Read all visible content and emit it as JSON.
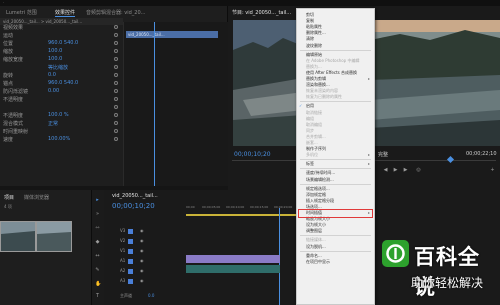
{
  "left_panel": {
    "tabs": [
      "Lumetri 范围",
      "效果控件",
      "音频剪辑混合器: vid_20..."
    ],
    "sequence_clip": "vid_20050..._tail... > vid_20050..._tail...",
    "timeline_clip": "vid_20050..._tail...",
    "props": [
      {
        "label": "视频效果",
        "value": ""
      },
      {
        "label": "运动",
        "value": ""
      },
      {
        "label": "位置",
        "value": "960.0   540.0"
      },
      {
        "label": "缩放",
        "value": "100.0"
      },
      {
        "label": "缩放宽度",
        "value": "100.0"
      },
      {
        "label": "",
        "value": "等比缩放"
      },
      {
        "label": "旋转",
        "value": "0.0"
      },
      {
        "label": "锚点",
        "value": "960.0   540.0"
      },
      {
        "label": "防闪烁滤镜",
        "value": "0.00"
      },
      {
        "label": "不透明度",
        "value": ""
      },
      {
        "label": "",
        "value": ""
      },
      {
        "label": "不透明度",
        "value": "100.0 %"
      },
      {
        "label": "混合模式",
        "value": "正常"
      },
      {
        "label": "时间重映射",
        "value": ""
      },
      {
        "label": "速度",
        "value": "100.00%"
      }
    ]
  },
  "program": {
    "tab": "节目: vid_20050..._tail...",
    "timecode": "00;00;10;20",
    "fit": "完整",
    "duration": "00;00;22;10"
  },
  "project": {
    "tabs": [
      "项目",
      "媒体浏览器"
    ],
    "search_label": "4 项"
  },
  "timeline": {
    "tab": "vid_20050..._tail...",
    "timecode": "00;00;10;20",
    "ruler": [
      "00;00",
      "00;00;05;00",
      "00;00;10;00",
      "00;00;15;00",
      "00;00;20;00"
    ],
    "tracks": [
      "V3",
      "V2",
      "V1",
      "A1",
      "A2",
      "A3",
      "主声道"
    ],
    "master_value": "0.0"
  },
  "context_menu": {
    "items": [
      {
        "label": "剪切",
        "enabled": true
      },
      {
        "label": "复制",
        "enabled": true
      },
      {
        "label": "粘贴属性",
        "enabled": true
      },
      {
        "label": "删除属性...",
        "enabled": true
      },
      {
        "label": "清除",
        "enabled": true
      },
      {
        "label": "波纹删除",
        "enabled": true
      },
      {
        "sep": true
      },
      {
        "label": "编辑原始",
        "enabled": true
      },
      {
        "label": "在 Adobe Photoshop 中编辑",
        "enabled": false
      },
      {
        "label": "替换为...",
        "enabled": false
      },
      {
        "label": "使用 After Effects 合成替换",
        "enabled": true
      },
      {
        "label": "替换为剪辑",
        "enabled": true,
        "submenu": true
      },
      {
        "label": "渲染和替换...",
        "enabled": true
      },
      {
        "label": "恢复未渲染的内容",
        "enabled": false
      },
      {
        "label": "恢复为已删除的属性",
        "enabled": false
      },
      {
        "sep": true
      },
      {
        "label": "启用",
        "enabled": true,
        "checked": true
      },
      {
        "label": "取消链接",
        "enabled": false
      },
      {
        "label": "编组",
        "enabled": false
      },
      {
        "label": "取消编组",
        "enabled": false
      },
      {
        "label": "同步",
        "enabled": false
      },
      {
        "label": "合并剪辑...",
        "enabled": false
      },
      {
        "label": "嵌套...",
        "enabled": false
      },
      {
        "label": "制作子序列",
        "enabled": true
      },
      {
        "label": "多机位",
        "enabled": false,
        "submenu": true
      },
      {
        "sep": true
      },
      {
        "label": "标签",
        "enabled": true,
        "submenu": true
      },
      {
        "sep": true
      },
      {
        "label": "速度/持续时间...",
        "enabled": true
      },
      {
        "label": "场景编辑检测...",
        "enabled": true
      },
      {
        "sep": true
      },
      {
        "label": "帧定格选项...",
        "enabled": true,
        "highlighted": true
      },
      {
        "label": "添加帧定格",
        "enabled": true
      },
      {
        "label": "插入帧定格分段",
        "enabled": true
      },
      {
        "label": "场选项...",
        "enabled": true
      },
      {
        "label": "时间插值",
        "enabled": true,
        "submenu": true
      },
      {
        "label": "缩放为帧大小",
        "enabled": true
      },
      {
        "label": "设为帧大小",
        "enabled": true
      },
      {
        "label": "调整图层",
        "enabled": true
      },
      {
        "sep": true
      },
      {
        "label": "链接媒体...",
        "enabled": false
      },
      {
        "label": "设为脱机...",
        "enabled": true
      },
      {
        "sep": true
      },
      {
        "label": "重命名...",
        "enabled": true
      },
      {
        "label": "在项目中显示",
        "enabled": true
      }
    ]
  },
  "watermark": {
    "title": "百科全说",
    "subtitle": "助你轻松解决"
  },
  "colors": {
    "accent_blue": "#4a8fe0",
    "highlight_red": "#e03a3a",
    "watermark_green": "#2da12d"
  }
}
